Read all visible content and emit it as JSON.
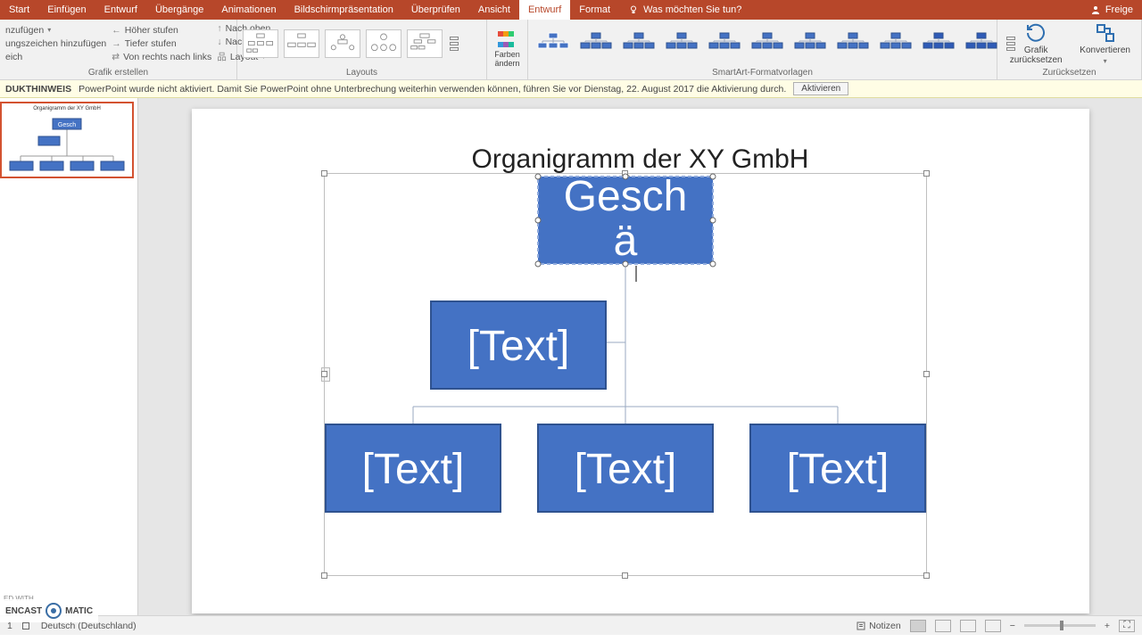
{
  "titlebar": {
    "tabs": [
      "Start",
      "Einfügen",
      "Entwurf",
      "Übergänge",
      "Animationen",
      "Bildschirmpräsentation",
      "Überprüfen",
      "Ansicht",
      "Entwurf",
      "Format"
    ],
    "active_tab_index": 8,
    "tell_me": "Was möchten Sie tun?",
    "share": "Freige"
  },
  "ribbon": {
    "create": {
      "col1": [
        "nzufügen",
        "ungszeichen hinzufügen",
        "eich"
      ],
      "col2": [
        "Höher stufen",
        "Tiefer stufen",
        "Von rechts nach links"
      ],
      "col3": [
        "Nach oben",
        "Nach unten",
        "Layout"
      ],
      "label": "Grafik erstellen"
    },
    "layouts_label": "Layouts",
    "colors_label": "Farben ändern",
    "styles_label": "SmartArt-Formatvorlagen",
    "reset": {
      "graphic": "Grafik zurücksetzen",
      "convert": "Konvertieren",
      "label": "Zurücksetzen"
    }
  },
  "notice": {
    "prefix": "DUKTHINWEIS",
    "text": "PowerPoint wurde nicht aktiviert. Damit Sie PowerPoint ohne Unterbrechung weiterhin verwenden können, führen Sie vor Dienstag, 22. August 2017 die Aktivierung durch.",
    "button": "Aktivieren"
  },
  "thumb": {
    "title": "Organigramm der XY GmbH",
    "box_label": "Gesch"
  },
  "slide": {
    "title": "Organigramm der XY GmbH",
    "root_line1": "Gesch",
    "root_line2": "ä",
    "placeholder": "[Text]"
  },
  "status": {
    "slide_no": "1",
    "language": "Deutsch (Deutschland)",
    "notes": "Notizen"
  },
  "watermark": {
    "cred": "ED WITH",
    "brand": "ENCAST    MATIC"
  },
  "colors": {
    "accent": "#4472c4",
    "accent_border": "#2f528f",
    "ribbon_active": "#b7472a",
    "notice_bg": "#fffde5"
  }
}
